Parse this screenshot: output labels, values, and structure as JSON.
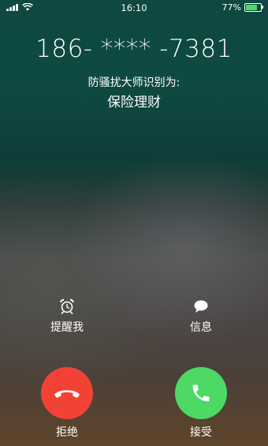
{
  "status_bar": {
    "time": "16:10",
    "battery_percent_text": "77%",
    "battery_level": 0.77
  },
  "caller": {
    "number": "186- **** -7381",
    "identification_label": "防骚扰大师识别为:",
    "identification_result": "保险理财"
  },
  "actions": {
    "remind_label": "提醒我",
    "message_label": "信息"
  },
  "call_buttons": {
    "decline_label": "拒绝",
    "accept_label": "接受"
  },
  "colors": {
    "decline": "#f24236",
    "accept": "#4cd964",
    "battery": "#4cd964"
  }
}
